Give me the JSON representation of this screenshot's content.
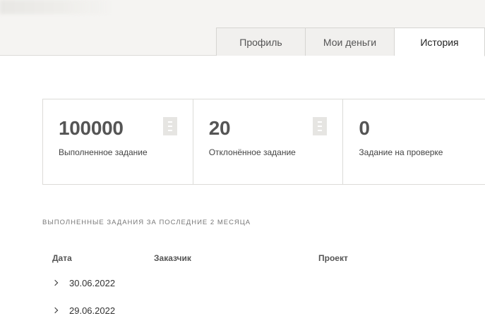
{
  "tabs": [
    {
      "label": "Профиль"
    },
    {
      "label": "Мои деньги"
    },
    {
      "label": "История"
    }
  ],
  "active_tab": "История",
  "stats": [
    {
      "value": "100000",
      "label": "Выполненное задание",
      "icon": "document-icon"
    },
    {
      "value": "20",
      "label": "Отклонённое задание",
      "icon": "document-icon"
    },
    {
      "value": "0",
      "label": "Задание на проверке"
    }
  ],
  "section_title": "ВЫПОЛНЕННЫЕ ЗАДАНИЯ ЗА ПОСЛЕДНИЕ 2 МЕСЯЦА",
  "table": {
    "headers": [
      "Дата",
      "Заказчик",
      "Проект"
    ],
    "rows": [
      {
        "date": "30.06.2022"
      },
      {
        "date": "29.06.2022"
      }
    ]
  }
}
